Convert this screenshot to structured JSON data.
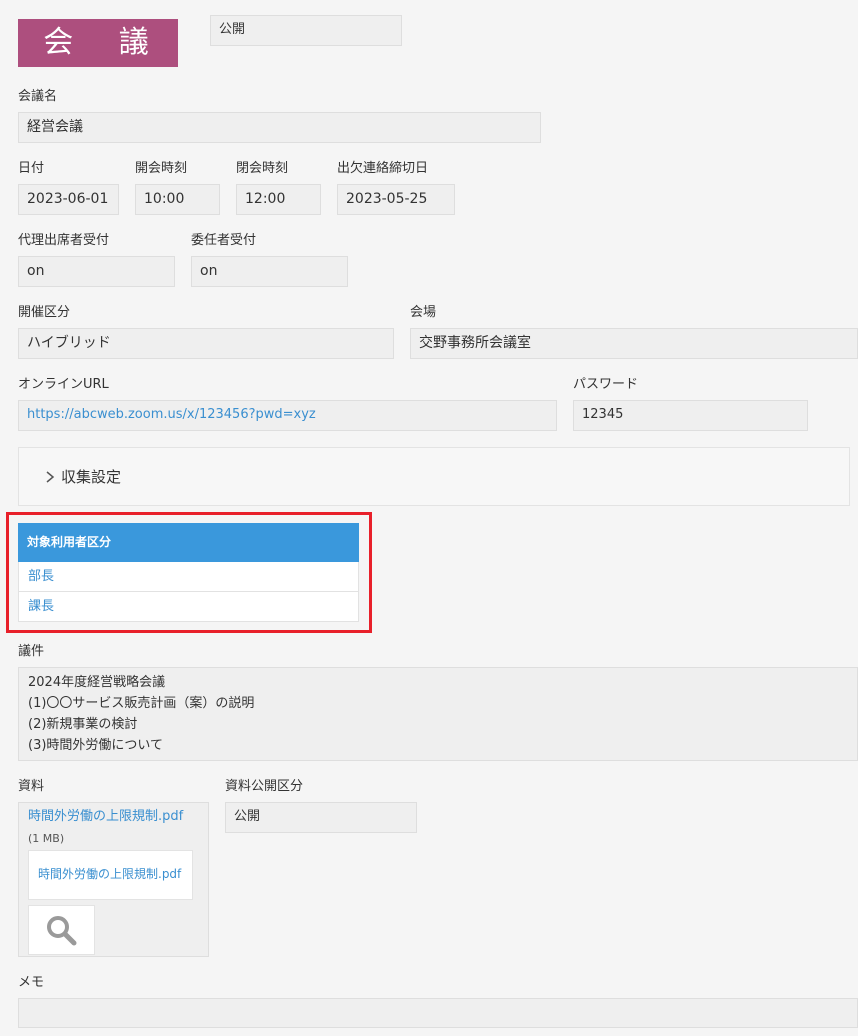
{
  "header": {
    "app_title": "会 議",
    "visibility_value": "公開"
  },
  "meeting_name": {
    "label": "会議名",
    "value": "経営会議"
  },
  "date": {
    "label": "日付",
    "value": "2023-06-01"
  },
  "start_time": {
    "label": "開会時刻",
    "value": "10:00"
  },
  "end_time": {
    "label": "閉会時刻",
    "value": "12:00"
  },
  "rsvp_deadline": {
    "label": "出欠連絡締切日",
    "value": "2023-05-25"
  },
  "proxy_reception": {
    "label": "代理出席者受付",
    "value": "on"
  },
  "delegate_reception": {
    "label": "委任者受付",
    "value": "on"
  },
  "format": {
    "label": "開催区分",
    "value": "ハイブリッド"
  },
  "venue": {
    "label": "会場",
    "value": "交野事務所会議室"
  },
  "online_url": {
    "label": "オンラインURL",
    "value": "https://abcweb.zoom.us/x/123456?pwd=xyz"
  },
  "password": {
    "label": "パスワード",
    "value": "12345"
  },
  "collection_settings": {
    "label": "収集設定",
    "icon": "chevron-right-icon"
  },
  "target_users": {
    "header": "対象利用者区分",
    "rows": [
      "部長",
      "課長"
    ],
    "highlight_color": "#e8202a",
    "header_color": "#3a98dc"
  },
  "agenda": {
    "label": "議件",
    "lines": [
      "2024年度経営戦略会議",
      "(1)〇〇サービス販売計画（案）の説明",
      "(2)新規事業の検討",
      "(3)時間外労働について"
    ]
  },
  "materials": {
    "label": "資料",
    "file_name": "時間外労働の上限規制.pdf",
    "file_size": "(1 MB)",
    "preview_text": "時間外労働の上限規制.pdf",
    "preview_icon": "magnifier-icon"
  },
  "materials_visibility": {
    "label": "資料公開区分",
    "value": "公開"
  },
  "memo": {
    "label": "メモ",
    "value": ""
  },
  "colors": {
    "brand": "#ad4f7e",
    "link": "#3a8fd0"
  }
}
